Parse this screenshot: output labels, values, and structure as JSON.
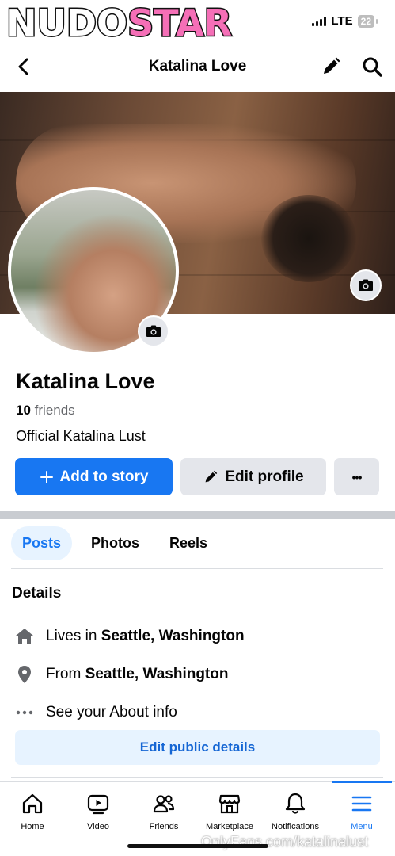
{
  "status_bar": {
    "logo_part1": "NUDO",
    "logo_part2": "STAR",
    "network": "LTE",
    "battery": "22"
  },
  "header": {
    "title": "Katalina Love",
    "back_icon": "chevron-left-icon",
    "edit_icon": "pencil-icon",
    "search_icon": "search-icon"
  },
  "profile": {
    "name": "Katalina Love",
    "friends_count": "10",
    "friends_label": "friends",
    "bio": "Official Katalina Lust"
  },
  "actions": {
    "add_story_label": "Add to story",
    "edit_profile_label": "Edit profile",
    "more_label": "•••"
  },
  "tabs": [
    {
      "label": "Posts",
      "active": true
    },
    {
      "label": "Photos",
      "active": false
    },
    {
      "label": "Reels",
      "active": false
    }
  ],
  "details": {
    "title": "Details",
    "lives_prefix": "Lives in",
    "lives_value": "Seattle, Washington",
    "from_prefix": "From",
    "from_value": "Seattle, Washington",
    "about_label": "See your About info",
    "edit_public_label": "Edit public details"
  },
  "nav": [
    {
      "label": "Home",
      "icon": "home-icon"
    },
    {
      "label": "Video",
      "icon": "video-icon"
    },
    {
      "label": "Friends",
      "icon": "friends-icon"
    },
    {
      "label": "Marketplace",
      "icon": "marketplace-icon"
    },
    {
      "label": "Notifications",
      "icon": "bell-icon"
    },
    {
      "label": "Menu",
      "icon": "menu-icon",
      "active": true
    }
  ],
  "watermark": "OnlyFans.com/katalinalust",
  "colors": {
    "accent": "#1877f2",
    "secondary_button": "#e4e6eb",
    "active_tab_bg": "#e7f3ff",
    "logo_pink": "#f56fb7"
  }
}
